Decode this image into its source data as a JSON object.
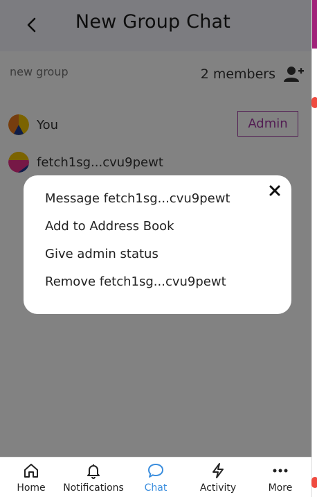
{
  "header": {
    "title": "New Group Chat",
    "back_icon": "chevron-left-icon"
  },
  "group": {
    "name": "new group",
    "members_count": "2 members",
    "add_member_icon": "add-person-icon"
  },
  "members": [
    {
      "name": "You",
      "role": "Admin"
    },
    {
      "name": "fetch1sg...cvu9pewt"
    }
  ],
  "modal": {
    "close_icon": "close-icon",
    "actions": [
      "Message fetch1sg...cvu9pewt",
      "Add to Address Book",
      "Give admin status",
      "Remove fetch1sg...cvu9pewt"
    ]
  },
  "nav": {
    "items": [
      {
        "label": "Home",
        "icon": "home-icon"
      },
      {
        "label": "Notifications",
        "icon": "bell-icon"
      },
      {
        "label": "Chat",
        "icon": "chat-bubble-icon",
        "active": true
      },
      {
        "label": "Activity",
        "icon": "lightning-icon"
      },
      {
        "label": "More",
        "icon": "more-dots-icon"
      }
    ]
  },
  "colors": {
    "accent_purple": "#a23aa3",
    "active_blue": "#3b8ede",
    "overlay": "rgba(0,0,0,0.49)"
  }
}
